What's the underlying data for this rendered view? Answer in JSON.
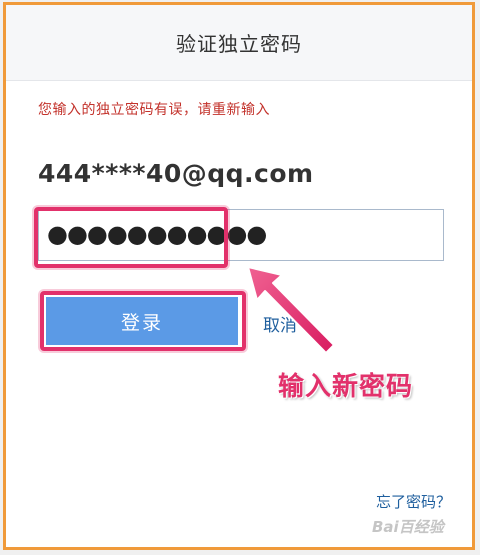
{
  "dialog": {
    "title": "验证独立密码",
    "error_message": "您输入的独立密码有误，请重新输入",
    "account": "444****40@qq.com",
    "password_value": "●●●●●●●●●●●",
    "login_label": "登录",
    "cancel_label": "取消",
    "forgot_label": "忘了密码？"
  },
  "annotation": {
    "text": "输入新密码"
  },
  "watermark": {
    "text": "Bai百经验"
  },
  "colors": {
    "frame_border": "#f09a3a",
    "error_text": "#c3322b",
    "button_bg": "#5b9ae6",
    "link_text": "#1f5f9e",
    "highlight": "#e2316b"
  }
}
